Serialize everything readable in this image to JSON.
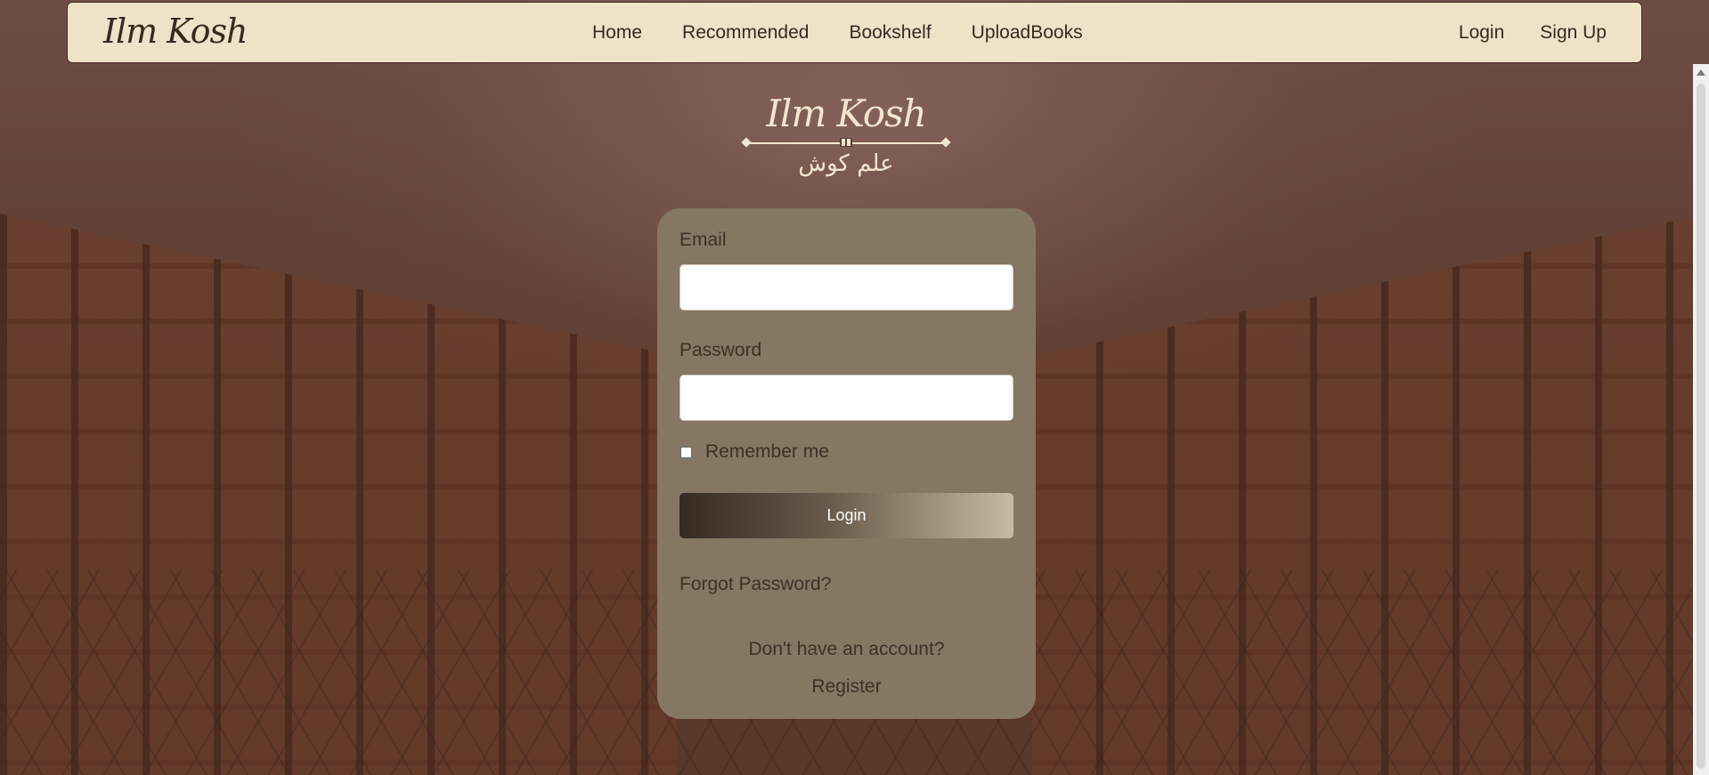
{
  "navbar": {
    "brand": "Ilm Kosh",
    "links": [
      {
        "label": "Home"
      },
      {
        "label": "Recommended"
      },
      {
        "label": "Bookshelf"
      },
      {
        "label": "UploadBooks"
      }
    ],
    "auth_links": [
      {
        "label": "Login"
      },
      {
        "label": "Sign Up"
      }
    ]
  },
  "emblem": {
    "title": "Ilm Kosh",
    "urdu": "علم کوش"
  },
  "login_form": {
    "email_label": "Email",
    "email_value": "",
    "password_label": "Password",
    "password_value": "",
    "remember_label": "Remember me",
    "remember_checked": false,
    "login_button": "Login",
    "forgot_password": "Forgot Password?",
    "no_account_text": "Don't have an account?",
    "register_link": "Register"
  },
  "colors": {
    "navbar_bg": "#efe2c8",
    "card_bg": "#857763",
    "text_dark": "#3e3026",
    "emblem_text": "#f3e6d0"
  },
  "icons": {
    "scroll_up": "triangle-up-icon",
    "divider_book": "book-icon"
  }
}
